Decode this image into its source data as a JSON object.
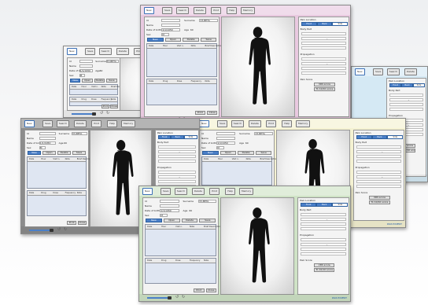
{
  "app": {
    "toolbar_tabs": [
      "New",
      "Save",
      "Search",
      "Delete",
      "Print",
      "Help",
      "Memory"
    ],
    "patient": {
      "labels": {
        "id": "Id",
        "surname": "Surname",
        "name": "Name",
        "date_of_birth": "Date of birth",
        "sex": "Sex",
        "age": "Age"
      },
      "values": {
        "surname": "33-BETA",
        "date_of_birth": "1/1/1950",
        "sex": "M",
        "age": "60"
      }
    },
    "list_buttons": [
      "New",
      "Open",
      "Delete",
      "Save"
    ],
    "visits_columns": [
      "Date",
      "Hour",
      "Visit n.",
      "Note",
      "Brief Description"
    ],
    "lower_columns": [
      "Date",
      "Drug",
      "Dose",
      "Frequency",
      "Note"
    ],
    "footer_buttons": [
      "Close",
      "Print"
    ],
    "right_panel": {
      "section1": "Pain Location",
      "tabs": [
        "Front",
        "Back",
        "Side"
      ],
      "body_part": "Body Part",
      "section2": "Propagation",
      "section3": "Pain Score",
      "score_label": "VRS score",
      "score_value": "To 10/10 score"
    },
    "brand": "PAIN EXPERT"
  },
  "themes": {
    "pink": "#e9c9e0",
    "gray": "#8c8c8c",
    "cream": "#f5f2d2",
    "green": "#cfe3c6",
    "white": "#f2f2f2",
    "blue": "#d5e9f4"
  }
}
